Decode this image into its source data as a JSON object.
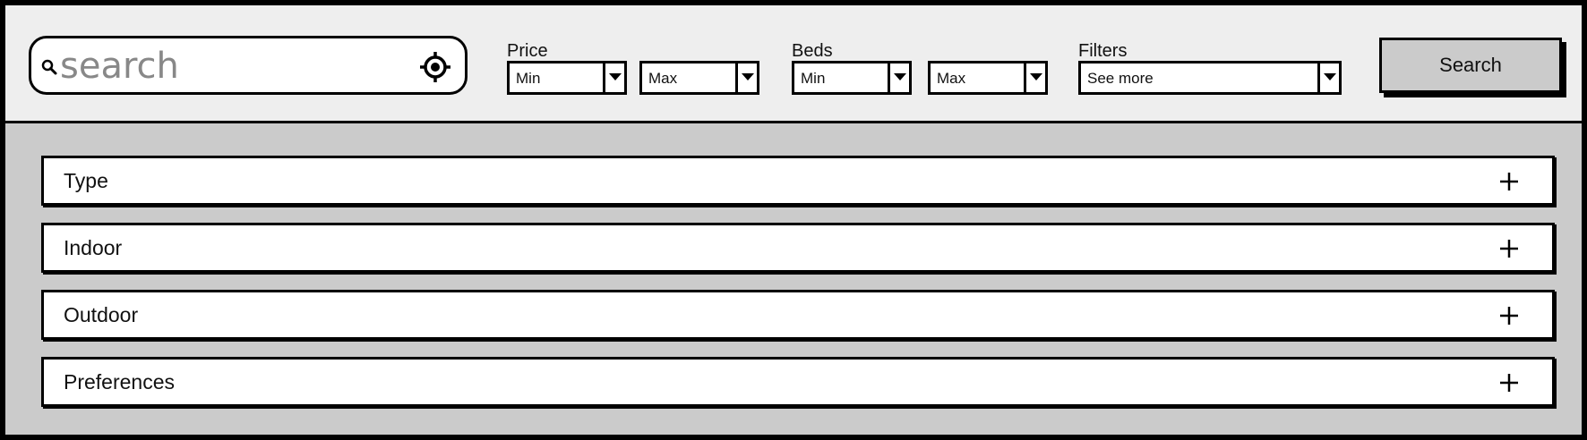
{
  "search": {
    "placeholder": "search"
  },
  "filters": {
    "price": {
      "label": "Price",
      "min": "Min",
      "max": "Max"
    },
    "beds": {
      "label": "Beds",
      "min": "Min",
      "max": "Max"
    },
    "more": {
      "label": "Filters",
      "value": "See more"
    }
  },
  "actions": {
    "search_label": "Search"
  },
  "sections": [
    {
      "label": "Type",
      "icon": "plus-icon"
    },
    {
      "label": "Indoor",
      "icon": "plus-icon"
    },
    {
      "label": "Outdoor",
      "icon": "plus-icon"
    },
    {
      "label": "Preferences",
      "icon": "plus-icon"
    }
  ],
  "colors": {
    "header_bg": "#eeeeee",
    "body_bg": "#cbcbcb",
    "button_bg": "#cbcbcb",
    "border": "#000000"
  }
}
